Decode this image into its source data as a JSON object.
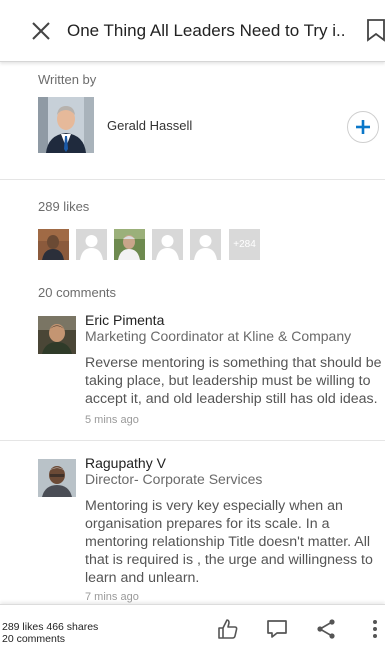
{
  "header": {
    "title": "One Thing All Leaders Need to Try i..."
  },
  "author": {
    "section_label": "Written by",
    "name": "Gerald Hassell"
  },
  "likes": {
    "label": "289 likes",
    "more_count": "+284"
  },
  "comments": {
    "label": "20 comments",
    "items": [
      {
        "name": "Eric Pimenta",
        "title": "Marketing Coordinator at Kline & Company",
        "body": "Reverse mentoring is something that should be taking place, but leadership must be willing to accept it, and old leadership still has old ideas.",
        "time": "5 mins ago"
      },
      {
        "name": "Ragupathy V",
        "title": "Director- Corporate Services",
        "body": "Mentoring is very key especially when an organisation prepares for its scale. In a mentoring relationship Title doesn't matter. All that is required is , the urge and willingness to learn and unlearn.",
        "time": "7 mins ago"
      }
    ]
  },
  "bottom_bar": {
    "likes_shares": "289 likes  466 shares",
    "comments_count": "20 comments"
  },
  "colors": {
    "accent": "#0a77c9",
    "divider": "#e5e5e5",
    "muted_text": "#6d6d6d"
  }
}
